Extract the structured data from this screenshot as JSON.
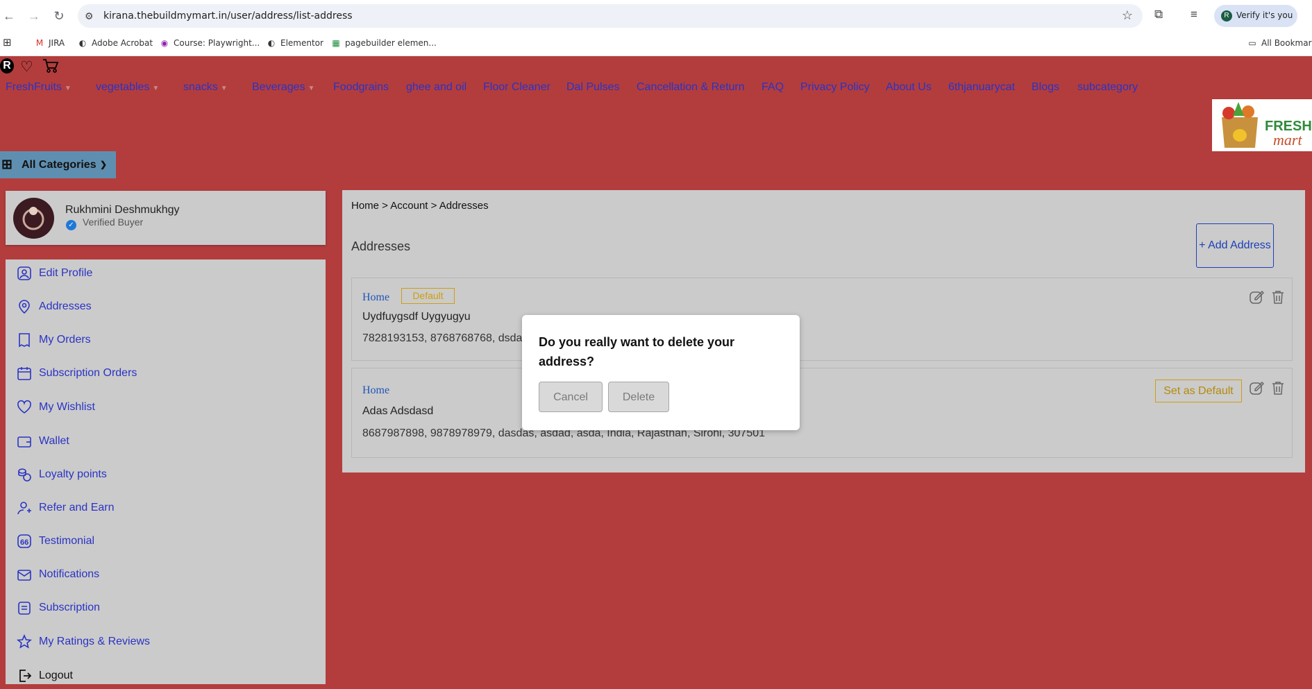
{
  "browser": {
    "url": "kirana.thebuildmymart.in/user/address/list-address",
    "verify_label": "Verify it's you",
    "verify_avatar": "R",
    "bookmarks": [
      "JIRA",
      "Adobe Acrobat",
      "Course: Playwright...",
      "Elementor",
      "pagebuilder elemen..."
    ],
    "all_bookmarks": "All Bookmarks"
  },
  "header": {
    "user_initial": "R",
    "menu": [
      "FreshFruits",
      "vegetables",
      "snacks",
      "Beverages",
      "Foodgrains",
      "ghee and oil",
      "Floor Cleaner",
      "Dal Pulses",
      "Cancellation & Return",
      "FAQ",
      "Privacy Policy",
      "About Us",
      "6thjanuarycat",
      "Blogs",
      "subcategory"
    ],
    "logo_text_1": "FRESH",
    "logo_text_2": "mart",
    "all_categories": "All Categories"
  },
  "profile": {
    "name": "Rukhmini Deshmukhgy",
    "status": "Verified Buyer"
  },
  "sidebar": {
    "items": [
      "Edit Profile",
      "Addresses",
      "My Orders",
      "Subscription Orders",
      "My Wishlist",
      "Wallet",
      "Loyalty points",
      "Refer and Earn",
      "Testimonial",
      "Notifications",
      "Subscription",
      "My Ratings & Reviews",
      "Logout"
    ]
  },
  "content": {
    "breadcrumb": "Home > Account > Addresses",
    "title": "Addresses",
    "add_button": "+ Add Address",
    "addresses": [
      {
        "type": "Home",
        "badge": "Default",
        "name": "Uydfuygsdf Uygyugyu",
        "detail": "7828193153, 8768768768, dsda"
      },
      {
        "type": "Home",
        "action": "Set as Default",
        "name": "Adas Adsdasd",
        "detail": "8687987898, 9878978979, dasdas, asdad, asda, India, Rajasthan, Sirohi, 307501"
      }
    ]
  },
  "modal": {
    "title": "Do you really want to delete your address?",
    "cancel": "Cancel",
    "delete": "Delete"
  }
}
